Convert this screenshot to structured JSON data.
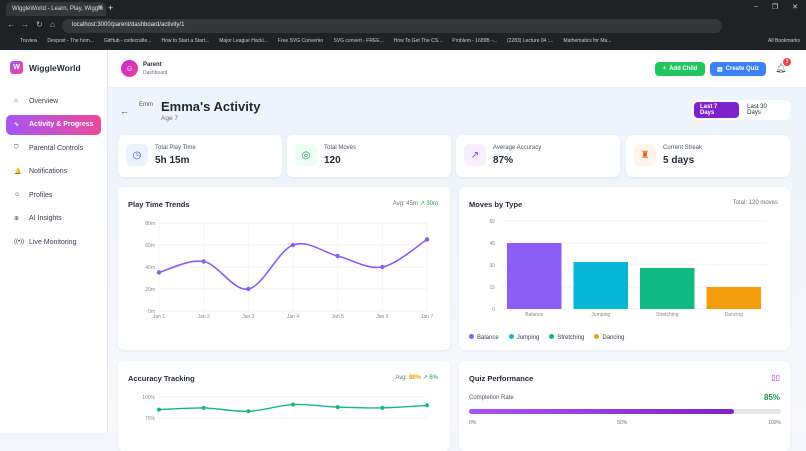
{
  "browser": {
    "tab_title": "WiggleWorld - Learn, Play, Wiggle",
    "url": "localhost:3000/parent/dashboard/activity/1",
    "bookmarks": [
      "Truview",
      "Devpost - The hom...",
      "GitHub - codecrafte...",
      "How to Start a Start...",
      "Major League Hacki...",
      "Free SVG Converter",
      "SVG convert - FREE...",
      "How To Get The CS...",
      "Problem - 1689B -...",
      "(2283) Lecture 04 :...",
      "Mathematics for Ma..."
    ],
    "all_bookmarks": "All Bookmarks"
  },
  "sidebar": {
    "brand": "WiggleWorld",
    "logo_letter": "W",
    "items": [
      {
        "label": "Overview",
        "icon": "⌂"
      },
      {
        "label": "Activity & Progress",
        "icon": "∿"
      },
      {
        "label": "Parental Controls",
        "icon": "⛉"
      },
      {
        "label": "Notifications",
        "icon": "🔔"
      },
      {
        "label": "Profiles",
        "icon": "☺"
      },
      {
        "label": "AI Insights",
        "icon": "⊕"
      },
      {
        "label": "Live Monitoring",
        "icon": "((•))"
      }
    ]
  },
  "header": {
    "role": "Parent",
    "subtitle": "Dashboard",
    "add_child": "Add Child",
    "create_quiz": "Create Quiz",
    "notif_count": "3"
  },
  "page": {
    "title": "Emma's Activity",
    "age": "Age 7",
    "img_alt": "Emm",
    "range": [
      "Last 7 Days",
      "Last 30 Days"
    ]
  },
  "stats": [
    {
      "label": "Total Play Time",
      "value": "5h 15m",
      "icon": "◷",
      "color": "#3b5bdb",
      "bg": "#eef2ff"
    },
    {
      "label": "Total Moves",
      "value": "120",
      "icon": "◎",
      "color": "#16a34a",
      "bg": "#ecfdf3"
    },
    {
      "label": "Average Accuracy",
      "value": "87%",
      "icon": "↗",
      "color": "#9333ea",
      "bg": "#f8f0ff"
    },
    {
      "label": "Current Streak",
      "value": "5 days",
      "icon": "♜",
      "color": "#ea580c",
      "bg": "#fff5ec"
    }
  ],
  "playtime": {
    "title": "Play Time Trends",
    "avg": "Avg: 45m",
    "delta": "↗ 30m"
  },
  "moves": {
    "title": "Moves by Type",
    "total": "Total: 120 moves"
  },
  "accuracy": {
    "title": "Accuracy Tracking",
    "avg_label": "Avg:",
    "avg": "88%",
    "delta": "↗ 6%"
  },
  "quiz": {
    "title": "Quiz Performance",
    "completion_label": "Completion Rate",
    "completion": "85%",
    "completion_value": 85,
    "ticks": [
      "0%",
      "50%",
      "100%"
    ]
  },
  "chart_data": [
    {
      "type": "line",
      "title": "Play Time Trends",
      "categories": [
        "Jan 1",
        "Jan 2",
        "Jan 3",
        "Jan 4",
        "Jan 5",
        "Jan 6",
        "Jan 7"
      ],
      "values": [
        35,
        45,
        20,
        60,
        50,
        40,
        65
      ],
      "ylim": [
        0,
        80
      ],
      "yticks": [
        "0m",
        "20m",
        "40m",
        "60m",
        "80m"
      ],
      "color": "#8b5cf6"
    },
    {
      "type": "bar",
      "title": "Moves by Type",
      "categories": [
        "Balance",
        "Jumping",
        "Stretching",
        "Dancing"
      ],
      "values": [
        45,
        32,
        28,
        15
      ],
      "colors": [
        "#8b5cf6",
        "#06b6d4",
        "#10b981",
        "#f59e0b"
      ],
      "ylim": [
        0,
        60
      ],
      "yticks": [
        "0",
        "15",
        "30",
        "45",
        "60"
      ],
      "legend": "bottom"
    },
    {
      "type": "line",
      "title": "Accuracy Tracking",
      "values": [
        85,
        87,
        83,
        91,
        88,
        87,
        90
      ],
      "yticks": [
        "75%",
        "100%"
      ],
      "color": "#10b981"
    }
  ]
}
